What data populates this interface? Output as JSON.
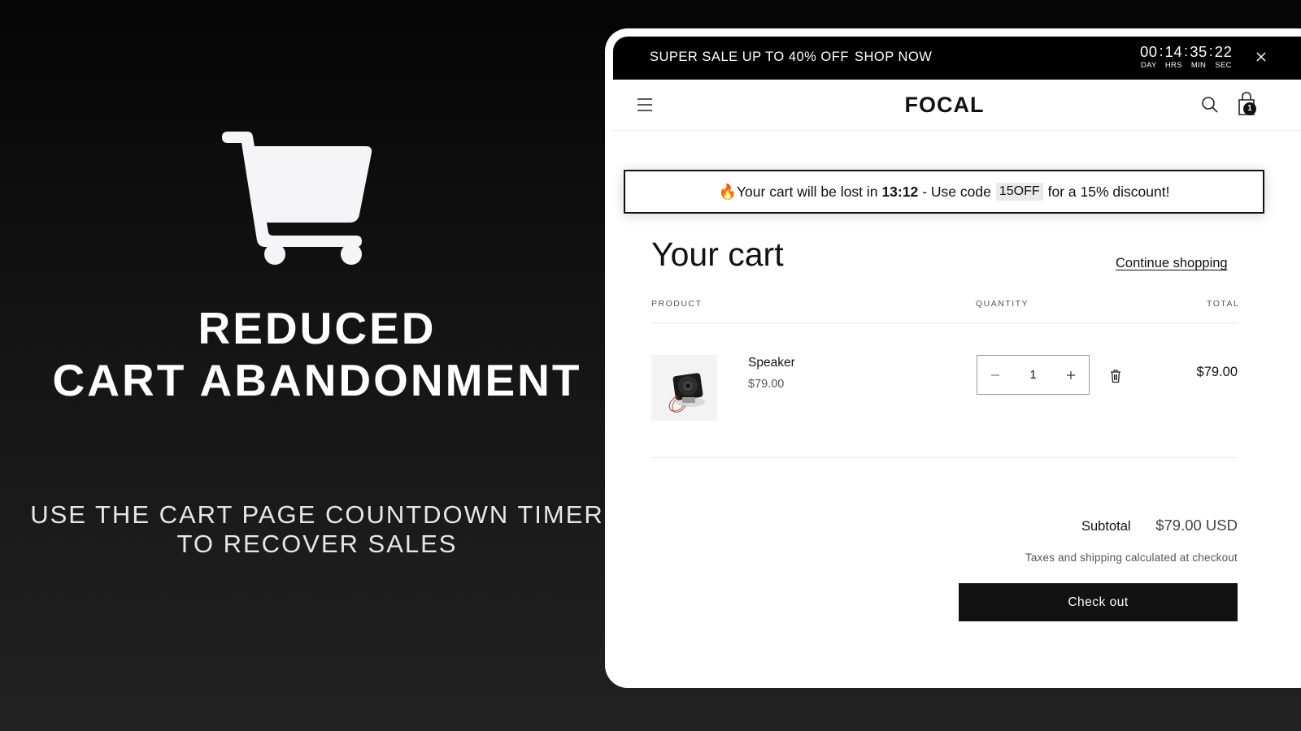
{
  "promo": {
    "icon": "shopping-cart-icon",
    "title_lines": [
      "REDUCED",
      "CART ABANDONMENT"
    ],
    "subtitle_lines": [
      "USE THE CART PAGE COUNTDOWN TIMER",
      "TO RECOVER SALES"
    ]
  },
  "store": {
    "announcement": {
      "text": "SUPER SALE UP TO 40% OFF",
      "link": "SHOP NOW",
      "countdown": [
        {
          "value": "00",
          "label": "DAY"
        },
        {
          "value": "14",
          "label": "HRS"
        },
        {
          "value": "35",
          "label": "MIN"
        },
        {
          "value": "22",
          "label": "SEC"
        }
      ],
      "separator": ":",
      "close_icon": "close-icon"
    },
    "header": {
      "logo": "FOCAL",
      "menu_icon": "hamburger-menu-icon",
      "search_icon": "search-icon",
      "cart_icon": "shopping-bag-icon",
      "cart_count": "1"
    },
    "timer_banner": {
      "icon": "fire-icon",
      "text_before": "Your cart will be lost in",
      "time": "13:12",
      "text_middle": "- Use code",
      "code": "15OFF",
      "text_after": "for a 15% discount!"
    },
    "cart": {
      "title": "Your cart",
      "continue_link": "Continue shopping",
      "columns": {
        "product": "PRODUCT",
        "quantity": "QUANTITY",
        "total": "TOTAL"
      },
      "items": [
        {
          "name": "Speaker",
          "price": "$79.00",
          "quantity": "1",
          "total": "$79.00",
          "image": "speaker-product-image"
        }
      ],
      "subtotal_label": "Subtotal",
      "subtotal_value": "$79.00 USD",
      "tax_note": "Taxes and shipping calculated at checkout",
      "checkout_label": "Check out"
    }
  }
}
